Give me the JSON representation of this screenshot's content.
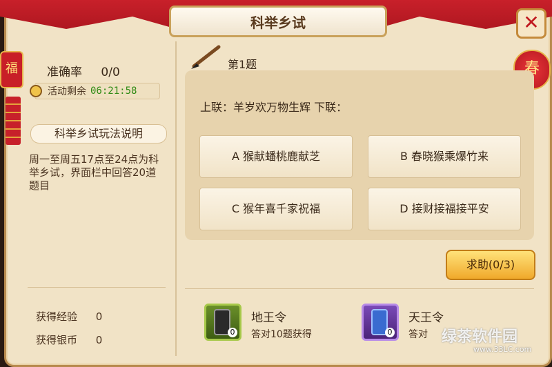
{
  "window": {
    "title": "科举乡试",
    "close_label": "✕"
  },
  "decor": {
    "fu_char": "福",
    "chun_char": "春"
  },
  "left": {
    "accuracy_label": "准确率",
    "accuracy_value": "0/0",
    "timer_label": "活动剩余",
    "timer_value": "06:21:58",
    "rules_title": "科举乡试玩法说明",
    "rules_text": "周一至周五17点至24点为科举乡试，界面栏中回答20道题目",
    "exp_label": "获得经验",
    "exp_value": "0",
    "silver_label": "获得银币",
    "silver_value": "0"
  },
  "question": {
    "number": "第1题",
    "text": "上联：羊岁欢万物生辉  下联：",
    "options": [
      {
        "key": "A",
        "text": "A 猴献蟠桃鹿献芝"
      },
      {
        "key": "B",
        "text": "B 春晓猴乘爆竹来"
      },
      {
        "key": "C",
        "text": "C 猴年喜千家祝福"
      },
      {
        "key": "D",
        "text": "D 接财接福接平安"
      }
    ],
    "help_label": "求助(0/3)"
  },
  "items": [
    {
      "name": "地王令",
      "desc": "答对10题获得",
      "count": "0",
      "icon": "scroll-green-icon"
    },
    {
      "name": "天王令",
      "desc": "答对",
      "count": "0",
      "icon": "scroll-purple-icon"
    }
  ],
  "watermark": {
    "text": "绿茶软件园",
    "url": "www.33LC.com"
  },
  "colors": {
    "timer_green": "#2e8a13",
    "help_gold": "#f0a92b",
    "curtain_red": "#c8202a"
  }
}
